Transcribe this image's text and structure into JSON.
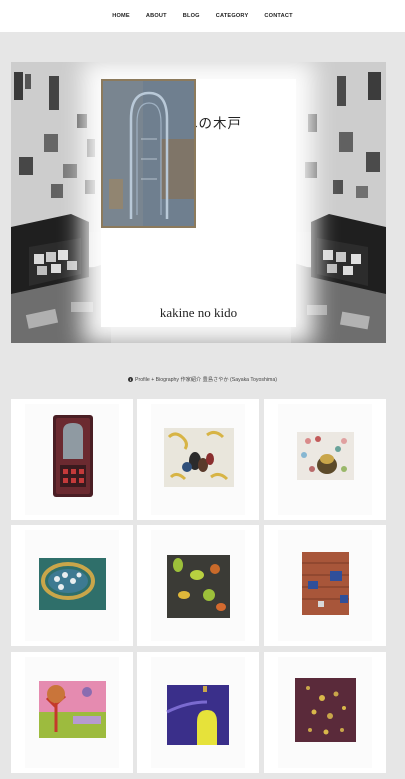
{
  "nav": {
    "items": [
      {
        "label": "HOME"
      },
      {
        "label": "ABOUT"
      },
      {
        "label": "BLOG"
      },
      {
        "label": "CATEGORY"
      },
      {
        "label": "CONTACT"
      }
    ]
  },
  "hero": {
    "title_jp": "かきねの木戸",
    "title_en": "kakine no kido"
  },
  "profile": {
    "text": "Profile + Biography 作家紹介 豊島さやか (Sayaka Toyoshima)"
  },
  "gallery": {
    "count": 9
  }
}
